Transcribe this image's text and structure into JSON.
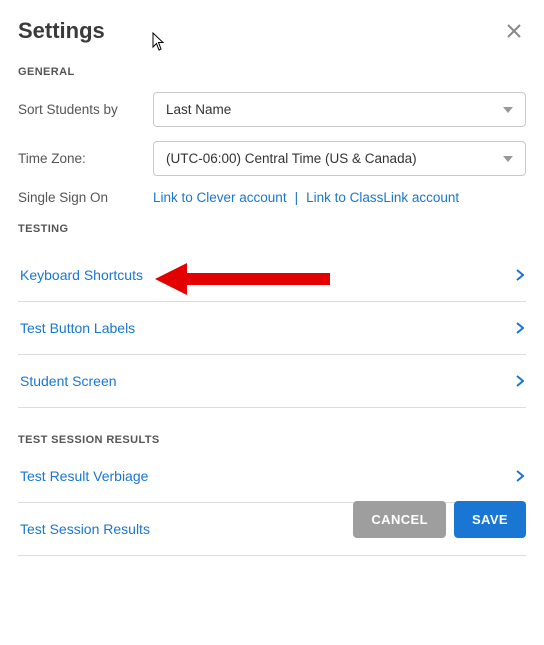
{
  "title": "Settings",
  "sections": {
    "general": {
      "header": "GENERAL",
      "sort_students_label": "Sort Students by",
      "sort_students_value": "Last Name",
      "timezone_label": "Time Zone:",
      "timezone_value": "(UTC-06:00) Central Time (US & Canada)",
      "sso_label": "Single Sign On",
      "sso_clever": "Link to Clever account",
      "sso_classlink": "Link to ClassLink account"
    },
    "testing": {
      "header": "TESTING",
      "items": [
        {
          "label": "Keyboard Shortcuts"
        },
        {
          "label": "Test Button Labels"
        },
        {
          "label": "Student Screen"
        }
      ]
    },
    "results": {
      "header": "TEST SESSION RESULTS",
      "items": [
        {
          "label": "Test Result Verbiage"
        },
        {
          "label": "Test Session Results"
        }
      ]
    }
  },
  "footer": {
    "cancel": "CANCEL",
    "save": "SAVE"
  }
}
